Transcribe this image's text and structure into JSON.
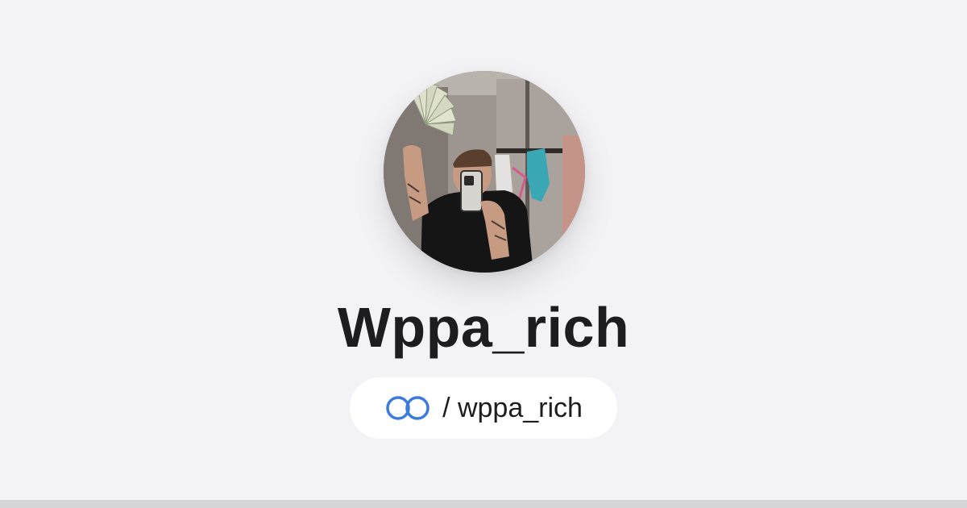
{
  "profile": {
    "display_name": "Wppa_rich",
    "handle_text": "/ wppa_rich",
    "avatar_description_icon": "profile-photo",
    "link_icon": "linktree-rings-icon"
  },
  "colors": {
    "background": "#f3f3f6",
    "pill_background": "#ffffff",
    "text": "#1d1d1f",
    "link_icon": "#3b7be0",
    "bottom_strip": "#d5d5d8"
  }
}
